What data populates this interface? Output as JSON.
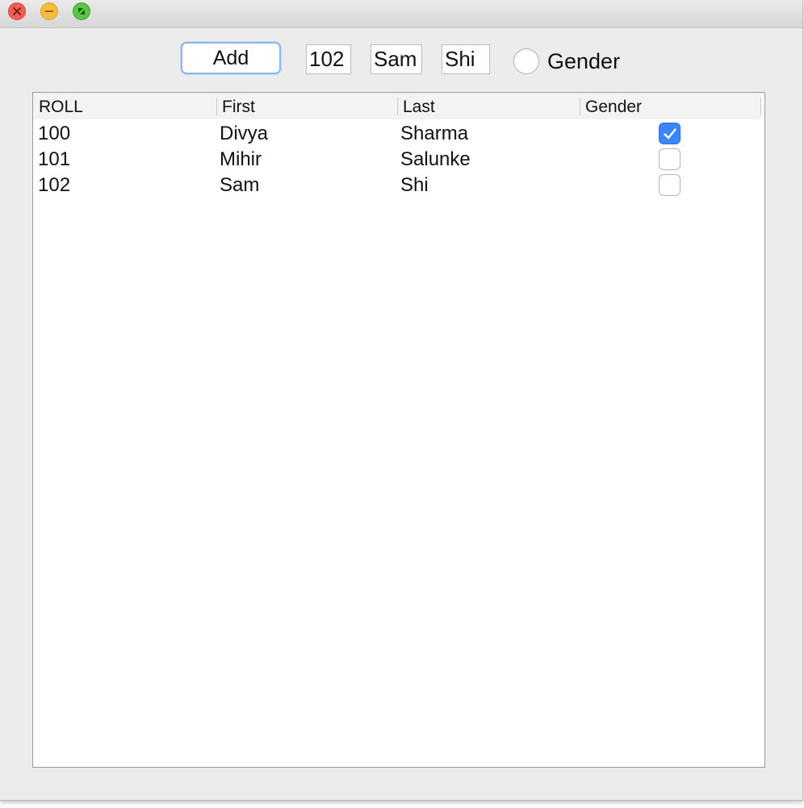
{
  "toolbar": {
    "add_label": "Add",
    "roll_value": "102",
    "first_value": "Sam",
    "last_value": "Shi",
    "gender_label": "Gender",
    "gender_selected": false
  },
  "table": {
    "columns": [
      "ROLL",
      "First",
      "Last",
      "Gender"
    ],
    "rows": [
      {
        "roll": "100",
        "first": "Divya",
        "last": "Sharma",
        "gender": true
      },
      {
        "roll": "101",
        "first": "Mihir",
        "last": "Salunke",
        "gender": false
      },
      {
        "roll": "102",
        "first": "Sam",
        "last": "Shi",
        "gender": false
      }
    ]
  },
  "colors": {
    "accent": "#3b86f7",
    "close": "#ee5f57",
    "minimize": "#f5bd3e",
    "maximize": "#5ac548"
  }
}
